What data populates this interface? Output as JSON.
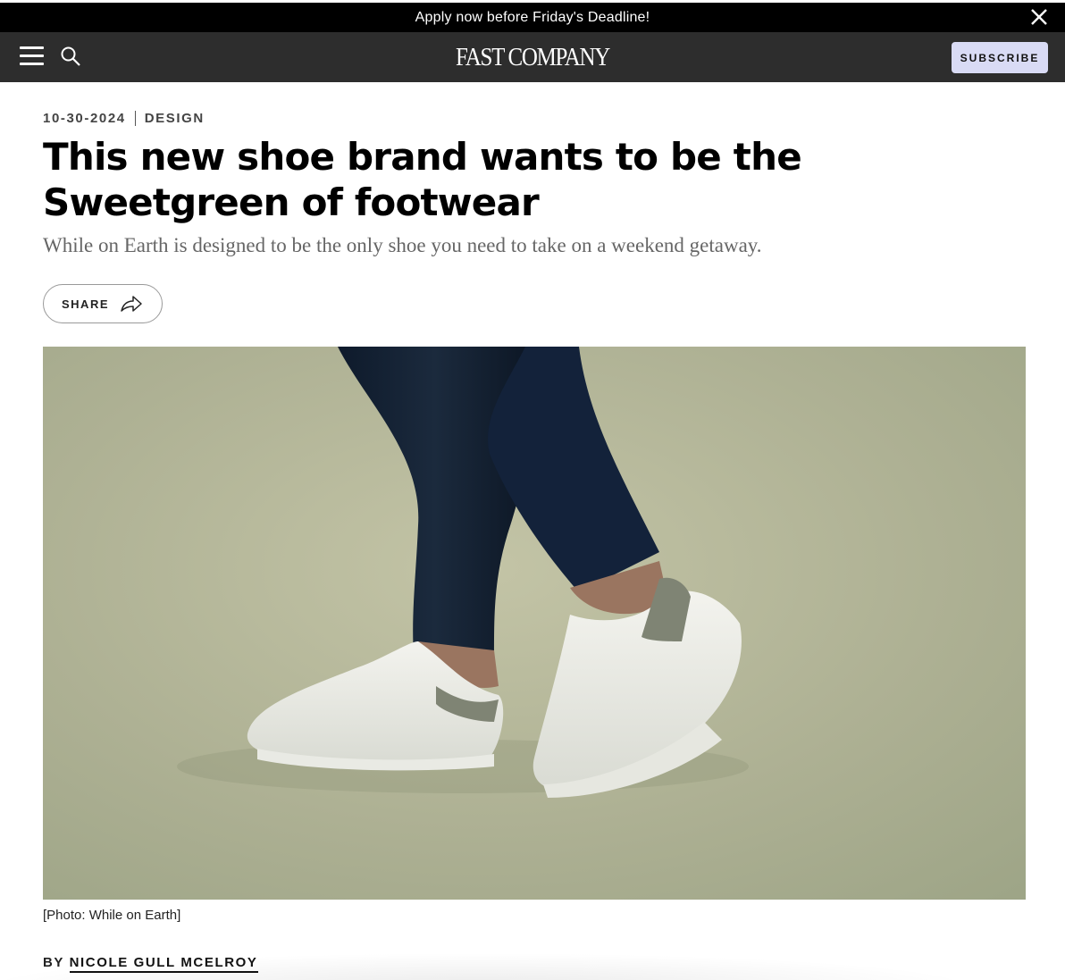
{
  "promo": {
    "text": "Apply now before Friday's Deadline!"
  },
  "nav": {
    "logo": "FAST COMPANY",
    "subscribe_label": "SUBSCRIBE"
  },
  "article": {
    "date": "10-30-2024",
    "section": "DESIGN",
    "headline": "This new shoe brand wants to be the Sweetgreen of footwear",
    "dek": "While on Earth is designed to be the only shoe you need to take on a weekend getaway.",
    "share_label": "SHARE",
    "caption": "[Photo: While on Earth]",
    "byline_prefix": "BY",
    "author": "NICOLE GULL MCELROY"
  },
  "colors": {
    "promo_bg": "#000000",
    "nav_bg": "#2d2d2d",
    "subscribe_bg": "#d9dbf5",
    "hero_bg": "#b3b596"
  }
}
